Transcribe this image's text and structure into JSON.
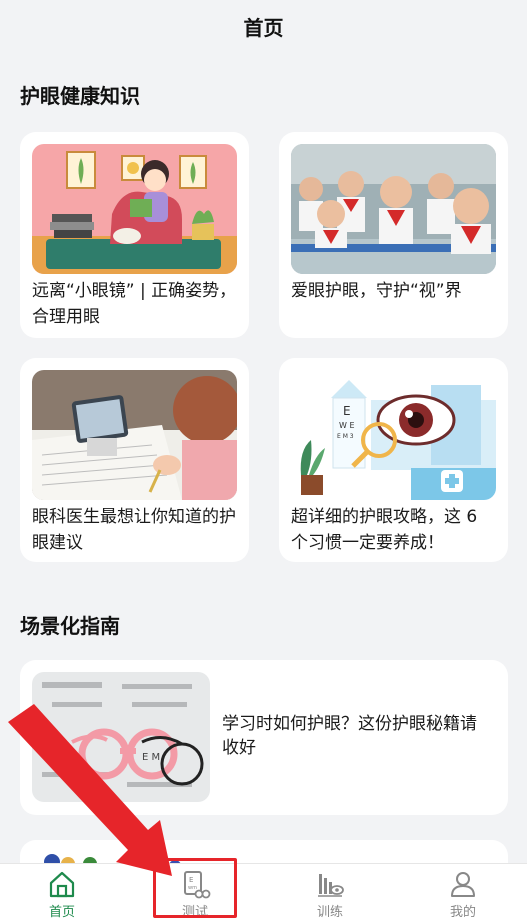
{
  "header": {
    "title": "首页"
  },
  "sections": {
    "eye_care": {
      "title": "护眼健康知识",
      "cards": [
        {
          "title": "远离“小眼镜” | 正确姿势，合理用眼"
        },
        {
          "title": "爱眼护眼，守护“视”界"
        },
        {
          "title": "眼科医生最想让你知道的护眼建议"
        },
        {
          "title": "超详细的护眼攻略，这 6 个习惯一定要养成！"
        }
      ]
    },
    "scenario": {
      "title": "场景化指南",
      "cards": [
        {
          "title": "学习时如何护眼？这份护眼秘籍请收好"
        }
      ]
    }
  },
  "tabbar": {
    "items": [
      {
        "label": "首页",
        "icon": "home-icon",
        "active": true
      },
      {
        "label": "测试",
        "icon": "eye-chart-icon",
        "active": false
      },
      {
        "label": "训练",
        "icon": "training-icon",
        "active": false
      },
      {
        "label": "我的",
        "icon": "profile-icon",
        "active": false
      }
    ]
  },
  "colors": {
    "accent": "#1e8a4c",
    "annotation": "#e6252a",
    "background": "#f2f3f5"
  }
}
